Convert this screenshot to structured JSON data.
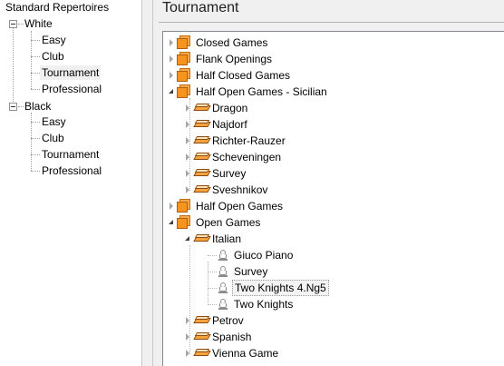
{
  "left_tree": {
    "root_label": "Standard Repertoires",
    "groups": [
      {
        "label": "White",
        "items": [
          "Easy",
          "Club",
          "Tournament",
          "Professional"
        ]
      },
      {
        "label": "Black",
        "items": [
          "Easy",
          "Club",
          "Tournament",
          "Professional"
        ]
      }
    ],
    "selected": "White / Tournament"
  },
  "right_panel": {
    "title": "Tournament",
    "tree": [
      {
        "label": "Closed Games",
        "icon": "folder-icon",
        "level": 0,
        "state": "collapsed"
      },
      {
        "label": "Flank Openings",
        "icon": "folder-icon",
        "level": 0,
        "state": "collapsed"
      },
      {
        "label": "Half Closed Games",
        "icon": "folder-icon",
        "level": 0,
        "state": "collapsed"
      },
      {
        "label": "Half Open Games - Sicilian",
        "icon": "folder-icon",
        "level": 0,
        "state": "expanded"
      },
      {
        "label": "Dragon",
        "icon": "book-icon",
        "level": 1,
        "state": "collapsed"
      },
      {
        "label": "Najdorf",
        "icon": "book-icon",
        "level": 1,
        "state": "collapsed"
      },
      {
        "label": "Richter-Rauzer",
        "icon": "book-icon",
        "level": 1,
        "state": "collapsed"
      },
      {
        "label": "Scheveningen",
        "icon": "book-icon",
        "level": 1,
        "state": "collapsed"
      },
      {
        "label": "Survey",
        "icon": "book-icon",
        "level": 1,
        "state": "collapsed"
      },
      {
        "label": "Sveshnikov",
        "icon": "book-icon",
        "level": 1,
        "state": "collapsed"
      },
      {
        "label": "Half Open Games",
        "icon": "folder-icon",
        "level": 0,
        "state": "collapsed"
      },
      {
        "label": "Open Games",
        "icon": "folder-icon",
        "level": 0,
        "state": "expanded"
      },
      {
        "label": "Italian",
        "icon": "book-icon",
        "level": 1,
        "state": "expanded"
      },
      {
        "label": "Giuco Piano",
        "icon": "pawn-icon",
        "level": 2,
        "state": "leaf"
      },
      {
        "label": "Survey",
        "icon": "pawn-icon",
        "level": 2,
        "state": "leaf"
      },
      {
        "label": "Two Knights 4.Ng5",
        "icon": "pawn-icon",
        "level": 2,
        "state": "leaf",
        "selected": true
      },
      {
        "label": "Two Knights",
        "icon": "pawn-icon",
        "level": 2,
        "state": "leaf"
      },
      {
        "label": "Petrov",
        "icon": "book-icon",
        "level": 1,
        "state": "collapsed"
      },
      {
        "label": "Spanish",
        "icon": "book-icon",
        "level": 1,
        "state": "collapsed"
      },
      {
        "label": "Vienna Game",
        "icon": "book-icon",
        "level": 1,
        "state": "collapsed"
      }
    ]
  },
  "colors": {
    "folder": "#f7941e",
    "selection": "#f3f3f3",
    "panel_bg": "#f0f0f0"
  }
}
